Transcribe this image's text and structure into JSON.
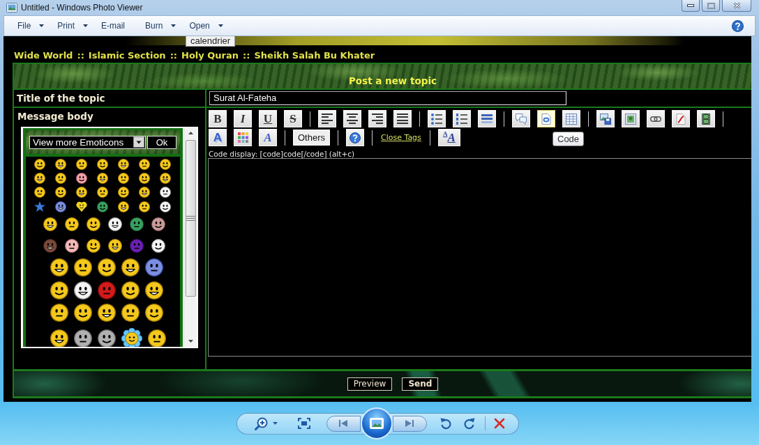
{
  "window": {
    "title": "Untitled - Windows Photo Viewer"
  },
  "menu": [
    {
      "label": "File",
      "dropdown": true
    },
    {
      "label": "Print",
      "dropdown": true
    },
    {
      "label": "E-mail",
      "dropdown": false
    },
    {
      "label": "Burn",
      "dropdown": true
    },
    {
      "label": "Open",
      "dropdown": true
    }
  ],
  "page": {
    "tooltip_top": "calendrier",
    "breadcrumb": [
      {
        "label": "Wide World"
      },
      {
        "separator": "::",
        "label": "Islamic Section"
      },
      {
        "separator": "::",
        "label": "Holy Quran"
      },
      {
        "separator": "::",
        "label": "Sheikh Salah Bu Khater"
      }
    ],
    "form": {
      "heading": "Post a new topic",
      "title_label": "Title of the topic",
      "title_value": "Surat Al-Fateha",
      "body_label": "Message body",
      "emoticons": {
        "select_value": "View more Emoticons",
        "ok_label": "Ok"
      },
      "toolbar": [
        [
          {
            "kind": "bold",
            "label": "B",
            "hovered": false
          },
          {
            "kind": "italic",
            "label": "I",
            "hovered": false
          },
          {
            "kind": "underline",
            "label": "U",
            "hovered": false
          },
          {
            "kind": "strike",
            "label": "S",
            "hovered": false
          },
          {
            "kind": "separator"
          },
          {
            "kind": "icon",
            "hovered": false
          },
          {
            "kind": "icon",
            "hovered": false
          },
          {
            "kind": "icon",
            "hovered": false
          },
          {
            "kind": "icon",
            "hovered": false
          },
          {
            "kind": "separator"
          },
          {
            "kind": "icon",
            "hovered": false
          },
          {
            "kind": "icon",
            "hovered": false
          },
          {
            "kind": "icon",
            "hovered": false
          },
          {
            "kind": "separator"
          },
          {
            "kind": "icon",
            "hovered": false
          },
          {
            "kind": "icon",
            "hovered": true
          },
          {
            "kind": "icon",
            "hovered": false
          },
          {
            "kind": "separator"
          },
          {
            "kind": "icon",
            "hovered": false
          },
          {
            "kind": "icon",
            "hovered": false
          },
          {
            "kind": "icon",
            "hovered": false
          },
          {
            "kind": "icon",
            "hovered": false
          },
          {
            "kind": "icon",
            "hovered": false
          },
          {
            "kind": "separator"
          }
        ],
        [
          {
            "kind": "shadow",
            "label": "A",
            "hovered": false
          },
          {
            "kind": "icon",
            "hovered": false
          },
          {
            "kind": "font",
            "label": "A",
            "hovered": false
          },
          {
            "kind": "separator"
          },
          {
            "kind": "button",
            "label": "Others",
            "hovered": false
          },
          {
            "kind": "separator"
          },
          {
            "kind": "icon",
            "hovered": false
          },
          {
            "kind": "separator"
          },
          {
            "kind": "link",
            "label": "Close Tags"
          },
          {
            "kind": "separator"
          },
          {
            "kind": "size",
            "label": "A",
            "small": "A",
            "hovered": false
          }
        ]
      ],
      "tooltip": "Code",
      "hint": "Code display: [code]code[/code] (alt+c)",
      "buttons": [
        {
          "label": "Preview",
          "default": false
        },
        {
          "label": "Send",
          "default": true
        }
      ]
    }
  }
}
